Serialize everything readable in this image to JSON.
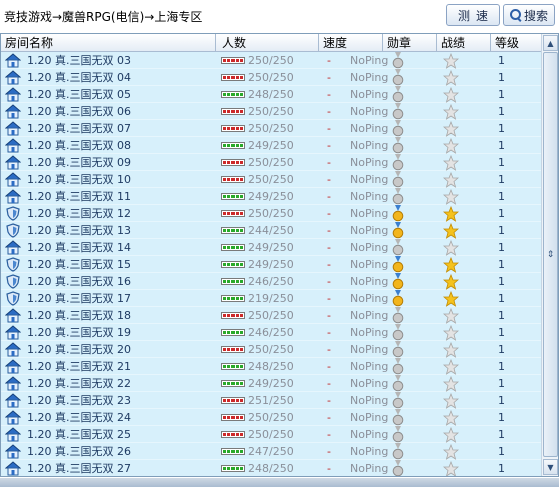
{
  "breadcrumb": "竞技游戏→魔兽RPG(电信)→上海专区",
  "toolbar": {
    "speed_label": "测速",
    "search_label": "搜索"
  },
  "columns": [
    "房间名称",
    "人数",
    "速度",
    "勋章",
    "战绩",
    "等级"
  ],
  "colors": {
    "bar_red": "#cc2a2a",
    "bar_green": "#2aa92a",
    "row_bg": "#d7f0fb"
  },
  "rows": [
    {
      "icon": "house-icon",
      "name": "1.20 真.三国无双 03",
      "count": "250/250",
      "bar": "red",
      "speed": "-",
      "ping": "NoPing",
      "medal": "gray",
      "star": "gray",
      "level": "1"
    },
    {
      "icon": "house-icon",
      "name": "1.20 真.三国无双 04",
      "count": "250/250",
      "bar": "red",
      "speed": "-",
      "ping": "NoPing",
      "medal": "gray",
      "star": "gray",
      "level": "1"
    },
    {
      "icon": "house-icon",
      "name": "1.20 真.三国无双 05",
      "count": "248/250",
      "bar": "green",
      "speed": "-",
      "ping": "NoPing",
      "medal": "gray",
      "star": "gray",
      "level": "1"
    },
    {
      "icon": "house-icon",
      "name": "1.20 真.三国无双 06",
      "count": "250/250",
      "bar": "red",
      "speed": "-",
      "ping": "NoPing",
      "medal": "gray",
      "star": "gray",
      "level": "1"
    },
    {
      "icon": "house-icon",
      "name": "1.20 真.三国无双 07",
      "count": "250/250",
      "bar": "red",
      "speed": "-",
      "ping": "NoPing",
      "medal": "gray",
      "star": "gray",
      "level": "1"
    },
    {
      "icon": "house-icon",
      "name": "1.20 真.三国无双 08",
      "count": "249/250",
      "bar": "green",
      "speed": "-",
      "ping": "NoPing",
      "medal": "gray",
      "star": "gray",
      "level": "1"
    },
    {
      "icon": "house-icon",
      "name": "1.20 真.三国无双 09",
      "count": "250/250",
      "bar": "red",
      "speed": "-",
      "ping": "NoPing",
      "medal": "gray",
      "star": "gray",
      "level": "1"
    },
    {
      "icon": "house-icon",
      "name": "1.20 真.三国无双 10",
      "count": "250/250",
      "bar": "red",
      "speed": "-",
      "ping": "NoPing",
      "medal": "gray",
      "star": "gray",
      "level": "1"
    },
    {
      "icon": "house-icon",
      "name": "1.20 真.三国无双 11",
      "count": "249/250",
      "bar": "green",
      "speed": "-",
      "ping": "NoPing",
      "medal": "gray",
      "star": "gray",
      "level": "1"
    },
    {
      "icon": "shield-icon",
      "name": "1.20 真.三国无双 12",
      "count": "250/250",
      "bar": "red",
      "speed": "-",
      "ping": "NoPing",
      "medal": "gold",
      "star": "gold",
      "level": "1"
    },
    {
      "icon": "shield-icon",
      "name": "1.20 真.三国无双 13",
      "count": "244/250",
      "bar": "green",
      "speed": "-",
      "ping": "NoPing",
      "medal": "gold",
      "star": "gold",
      "level": "1"
    },
    {
      "icon": "house-icon",
      "name": "1.20 真.三国无双 14",
      "count": "249/250",
      "bar": "green",
      "speed": "-",
      "ping": "NoPing",
      "medal": "gray",
      "star": "gray",
      "level": "1"
    },
    {
      "icon": "shield-icon",
      "name": "1.20 真.三国无双 15",
      "count": "249/250",
      "bar": "green",
      "speed": "-",
      "ping": "NoPing",
      "medal": "gold",
      "star": "gold",
      "level": "1"
    },
    {
      "icon": "shield-icon",
      "name": "1.20 真.三国无双 16",
      "count": "246/250",
      "bar": "green",
      "speed": "-",
      "ping": "NoPing",
      "medal": "gold",
      "star": "gold",
      "level": "1"
    },
    {
      "icon": "shield-icon",
      "name": "1.20 真.三国无双 17",
      "count": "219/250",
      "bar": "green",
      "speed": "-",
      "ping": "NoPing",
      "medal": "gold",
      "star": "gold",
      "level": "1"
    },
    {
      "icon": "house-icon",
      "name": "1.20 真.三国无双 18",
      "count": "250/250",
      "bar": "red",
      "speed": "-",
      "ping": "NoPing",
      "medal": "gray",
      "star": "gray",
      "level": "1"
    },
    {
      "icon": "house-icon",
      "name": "1.20 真.三国无双 19",
      "count": "246/250",
      "bar": "green",
      "speed": "-",
      "ping": "NoPing",
      "medal": "gray",
      "star": "gray",
      "level": "1"
    },
    {
      "icon": "house-icon",
      "name": "1.20 真.三国无双 20",
      "count": "250/250",
      "bar": "red",
      "speed": "-",
      "ping": "NoPing",
      "medal": "gray",
      "star": "gray",
      "level": "1"
    },
    {
      "icon": "house-icon",
      "name": "1.20 真.三国无双 21",
      "count": "248/250",
      "bar": "green",
      "speed": "-",
      "ping": "NoPing",
      "medal": "gray",
      "star": "gray",
      "level": "1"
    },
    {
      "icon": "house-icon",
      "name": "1.20 真.三国无双 22",
      "count": "249/250",
      "bar": "green",
      "speed": "-",
      "ping": "NoPing",
      "medal": "gray",
      "star": "gray",
      "level": "1"
    },
    {
      "icon": "house-icon",
      "name": "1.20 真.三国无双 23",
      "count": "251/250",
      "bar": "red",
      "speed": "-",
      "ping": "NoPing",
      "medal": "gray",
      "star": "gray",
      "level": "1"
    },
    {
      "icon": "house-icon",
      "name": "1.20 真.三国无双 24",
      "count": "250/250",
      "bar": "red",
      "speed": "-",
      "ping": "NoPing",
      "medal": "gray",
      "star": "gray",
      "level": "1"
    },
    {
      "icon": "house-icon",
      "name": "1.20 真.三国无双 25",
      "count": "250/250",
      "bar": "red",
      "speed": "-",
      "ping": "NoPing",
      "medal": "gray",
      "star": "gray",
      "level": "1"
    },
    {
      "icon": "house-icon",
      "name": "1.20 真.三国无双 26",
      "count": "247/250",
      "bar": "green",
      "speed": "-",
      "ping": "NoPing",
      "medal": "gray",
      "star": "gray",
      "level": "1"
    },
    {
      "icon": "house-icon",
      "name": "1.20 真.三国无双 27",
      "count": "248/250",
      "bar": "green",
      "speed": "-",
      "ping": "NoPing",
      "medal": "gray",
      "star": "gray",
      "level": "1"
    }
  ]
}
